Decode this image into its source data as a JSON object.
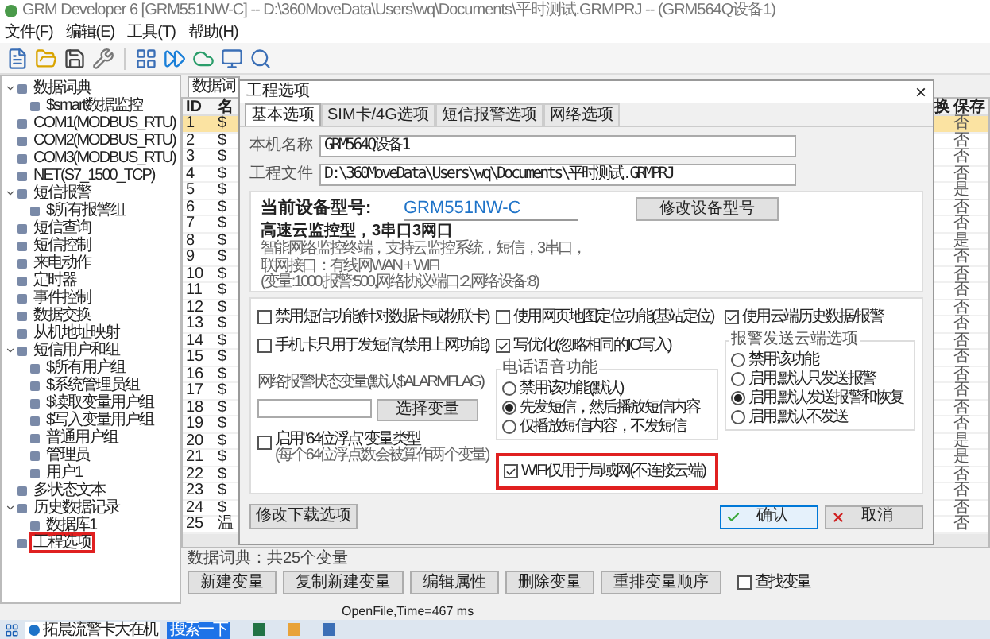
{
  "window": {
    "title": "GRM Developer 6 [GRM551NW-C]  -- D:\\360MoveData\\Users\\wq\\Documents\\平时测试.GRMPRJ -- (GRM564Q设备1)"
  },
  "menu": [
    "文件(F)",
    "编辑(E)",
    "工具(T)",
    "帮助(H)"
  ],
  "tree": [
    {
      "label": "数据词典",
      "expanded": true,
      "highlighted": false,
      "children": [
        {
          "label": "$smart数据监控",
          "highlighted": false
        }
      ]
    },
    {
      "label": "COM1(MODBUS_RTU)",
      "highlighted": false
    },
    {
      "label": "COM2(MODBUS_RTU)",
      "highlighted": false
    },
    {
      "label": "COM3(MODBUS_RTU)",
      "highlighted": false
    },
    {
      "label": "NET(S7_1500_TCP)",
      "highlighted": false
    },
    {
      "label": "短信报警",
      "expanded": true,
      "highlighted": false,
      "children": [
        {
          "label": "$所有报警组",
          "highlighted": false
        }
      ]
    },
    {
      "label": "短信查询",
      "highlighted": false
    },
    {
      "label": "短信控制",
      "highlighted": false
    },
    {
      "label": "来电动作",
      "highlighted": false
    },
    {
      "label": "定时器",
      "highlighted": false
    },
    {
      "label": "事件控制",
      "highlighted": false
    },
    {
      "label": "数据交换",
      "highlighted": false
    },
    {
      "label": "从机地址映射",
      "highlighted": false
    },
    {
      "label": "短信用户和组",
      "expanded": true,
      "highlighted": false,
      "children": [
        {
          "label": "$所有用户组",
          "highlighted": false
        },
        {
          "label": "$系统管理员组",
          "highlighted": false
        },
        {
          "label": "$读取变量用户组",
          "highlighted": false
        },
        {
          "label": "$写入变量用户组",
          "highlighted": false
        },
        {
          "label": "普通用户组",
          "highlighted": false
        },
        {
          "label": "管理员",
          "highlighted": false
        },
        {
          "label": "用户1",
          "highlighted": false
        }
      ]
    },
    {
      "label": "多状态文本",
      "highlighted": false
    },
    {
      "label": "历史数据记录",
      "expanded": true,
      "highlighted": false,
      "children": [
        {
          "label": "数据库1",
          "highlighted": false
        }
      ]
    },
    {
      "label": "工程选项",
      "highlighted": true
    }
  ],
  "tabs": [
    {
      "label": "数据词",
      "selected": true
    }
  ],
  "table": {
    "columns": [
      "ID",
      "名",
      "换",
      "保存"
    ],
    "rows": [
      {
        "id": "1",
        "name": "$",
        "save": "否",
        "selected": true
      },
      {
        "id": "2",
        "name": "$",
        "save": "否",
        "selected": false
      },
      {
        "id": "3",
        "name": "$",
        "save": "否",
        "selected": false
      },
      {
        "id": "4",
        "name": "$",
        "save": "否",
        "selected": false
      },
      {
        "id": "5",
        "name": "$",
        "save": "是",
        "selected": false
      },
      {
        "id": "6",
        "name": "$",
        "save": "否",
        "selected": false
      },
      {
        "id": "7",
        "name": "$",
        "save": "否",
        "selected": false
      },
      {
        "id": "8",
        "name": "$",
        "save": "是",
        "selected": false
      },
      {
        "id": "9",
        "name": "$",
        "save": "否",
        "selected": false
      },
      {
        "id": "10",
        "name": "$",
        "save": "否",
        "selected": false
      },
      {
        "id": "11",
        "name": "$",
        "save": "否",
        "selected": false
      },
      {
        "id": "12",
        "name": "$",
        "save": "否",
        "selected": false
      },
      {
        "id": "13",
        "name": "$",
        "save": "否",
        "selected": false
      },
      {
        "id": "14",
        "name": "$",
        "save": "否",
        "selected": false
      },
      {
        "id": "15",
        "name": "$",
        "save": "否",
        "selected": false
      },
      {
        "id": "16",
        "name": "$",
        "save": "否",
        "selected": false
      },
      {
        "id": "17",
        "name": "$",
        "save": "否",
        "selected": false
      },
      {
        "id": "18",
        "name": "$",
        "save": "否",
        "selected": false
      },
      {
        "id": "19",
        "name": "$",
        "save": "否",
        "selected": false
      },
      {
        "id": "20",
        "name": "$",
        "save": "是",
        "selected": false
      },
      {
        "id": "21",
        "name": "$",
        "save": "是",
        "selected": false
      },
      {
        "id": "22",
        "name": "$",
        "save": "否",
        "selected": false
      },
      {
        "id": "23",
        "name": "$",
        "save": "否",
        "selected": false
      },
      {
        "id": "24",
        "name": "$",
        "save": "否",
        "selected": false
      },
      {
        "id": "25",
        "name": "温",
        "save": "否",
        "selected": false
      }
    ]
  },
  "footer": {
    "summary": "数据词典：共25个变量",
    "buttons": [
      "新建变量",
      "复制新建变量",
      "编辑属性",
      "删除变量",
      "重排变量顺序"
    ],
    "search_checkbox": {
      "label": "查找变量",
      "checked": false
    }
  },
  "status_bar": "OpenFile,Time=467 ms",
  "taskbar": {
    "app_label": "拓晨流警卡大在机",
    "search_label": "搜索一下"
  },
  "dialog": {
    "title": "工程选项",
    "close": "×",
    "tabs": [
      {
        "label": "基本选项",
        "selected": true
      },
      {
        "label": "SIM卡/4G选项",
        "selected": false
      },
      {
        "label": "短信报警选项",
        "selected": false
      },
      {
        "label": "网络选项",
        "selected": false
      }
    ],
    "fields": [
      {
        "label": "本机名称",
        "value": "GRM564Q设备1"
      },
      {
        "label": "工程文件",
        "value": "D:\\360MoveData\\Users\\wq\\Documents\\平时测试.GRMPRJ"
      }
    ],
    "device": {
      "label": "当前设备型号:",
      "model": "GRM551NW-C",
      "button": "修改设备型号",
      "heading": "高速云监控型，3串口3网口",
      "lines": [
        "智能网络监控终端，支持云监控系统，短信，3串口，",
        "联网接口：有线网WAN + WIFI",
        "(变量:1000,报警:500,网络协议端口:2,网络设备:8)"
      ]
    },
    "left": {
      "checkboxes": [
        {
          "label": "禁用短信功能(针对数据卡或物联卡)",
          "checked": false
        },
        {
          "label": "手机卡只用于发短信(禁用上网功能)",
          "checked": false
        }
      ],
      "variable_label": "网络报警状态变量(默认$ALARMFLAG)",
      "select_button": "选择变量",
      "float64": {
        "label": "启用\"64位浮点\"变量类型",
        "note": "(每个64位浮点数会被算作两个变量)",
        "checked": false
      }
    },
    "middle": {
      "checkboxes": [
        {
          "label": "使用网页地图定位功能(基站定位)",
          "checked": false
        },
        {
          "label": "写优化(忽略相同的IO写入)",
          "checked": true
        }
      ],
      "voice": {
        "title": "电话语音功能",
        "options": [
          {
            "label": "禁用该功能(默认)",
            "selected": false
          },
          {
            "label": "先发短信，然后播放短信内容",
            "selected": true
          },
          {
            "label": "仅播放短信内容，不发短信",
            "selected": false
          }
        ]
      },
      "wifi": {
        "label": "WIFI仅用于局域网(不连接云端)",
        "checked": true,
        "highlighted": true
      }
    },
    "right": {
      "cloud": {
        "label": "使用云端历史数据/报警",
        "checked": true
      },
      "alarm": {
        "title": "报警发送云端选项",
        "options": [
          {
            "label": "禁用该功能",
            "selected": false
          },
          {
            "label": "启用,默认只发送报警",
            "selected": false
          },
          {
            "label": "启用,默认发送报警和恢复",
            "selected": true
          },
          {
            "label": "启用,默认不发送",
            "selected": false
          }
        ]
      }
    },
    "download_button": "修改下载选项",
    "ok": "确认",
    "cancel": "取消"
  }
}
